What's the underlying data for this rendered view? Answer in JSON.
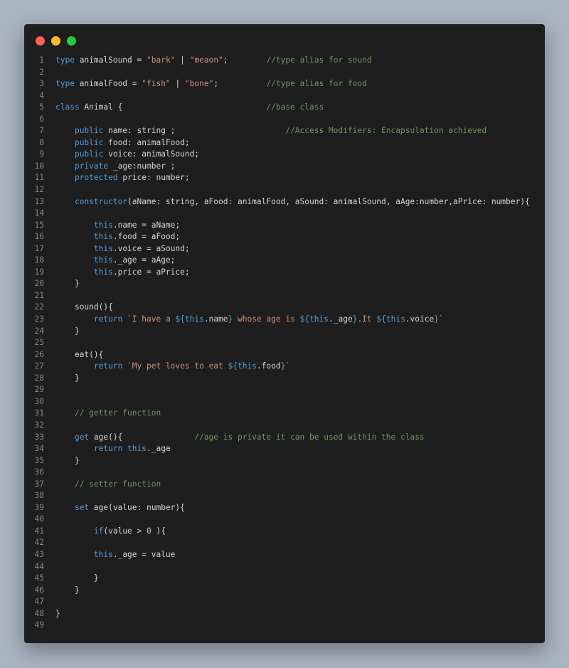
{
  "window": {
    "traffic_lights": [
      {
        "name": "close",
        "color": "#ff5f56"
      },
      {
        "name": "minimize",
        "color": "#ffbd2e"
      },
      {
        "name": "maximize",
        "color": "#27c93f"
      }
    ]
  },
  "theme": {
    "keyword": "#569cd6",
    "string": "#ce9178",
    "comment": "#6a9955",
    "number": "#b5cea8",
    "plain": "#d4d4d4",
    "line_number": "#858585",
    "background": "#1e1e1e"
  },
  "lines": [
    {
      "n": "1",
      "tokens": [
        {
          "t": "kw",
          "v": "type"
        },
        {
          "t": "pl",
          "v": " animalSound = "
        },
        {
          "t": "str",
          "v": "\"bark\""
        },
        {
          "t": "pl",
          "v": " | "
        },
        {
          "t": "str",
          "v": "\"meaon\""
        },
        {
          "t": "pl",
          "v": ";        "
        },
        {
          "t": "cm",
          "v": "//type alias for sound"
        }
      ]
    },
    {
      "n": "2",
      "tokens": []
    },
    {
      "n": "3",
      "tokens": [
        {
          "t": "kw",
          "v": "type"
        },
        {
          "t": "pl",
          "v": " animalFood = "
        },
        {
          "t": "str",
          "v": "\"fish\""
        },
        {
          "t": "pl",
          "v": " | "
        },
        {
          "t": "str",
          "v": "\"bone\""
        },
        {
          "t": "pl",
          "v": ";          "
        },
        {
          "t": "cm",
          "v": "//type alias for food"
        }
      ]
    },
    {
      "n": "4",
      "tokens": []
    },
    {
      "n": "5",
      "tokens": [
        {
          "t": "kw",
          "v": "class"
        },
        {
          "t": "pl",
          "v": " Animal {                              "
        },
        {
          "t": "cm",
          "v": "//base class"
        }
      ]
    },
    {
      "n": "6",
      "tokens": []
    },
    {
      "n": "7",
      "tokens": [
        {
          "t": "pl",
          "v": "    "
        },
        {
          "t": "kw",
          "v": "public"
        },
        {
          "t": "pl",
          "v": " name: string ;                       "
        },
        {
          "t": "cm",
          "v": "//Access Modifiers: Encapsulation achieved"
        }
      ]
    },
    {
      "n": "8",
      "tokens": [
        {
          "t": "pl",
          "v": "    "
        },
        {
          "t": "kw",
          "v": "public"
        },
        {
          "t": "pl",
          "v": " food: animalFood;"
        }
      ]
    },
    {
      "n": "9",
      "tokens": [
        {
          "t": "pl",
          "v": "    "
        },
        {
          "t": "kw",
          "v": "public"
        },
        {
          "t": "pl",
          "v": " voice: animalSound;"
        }
      ]
    },
    {
      "n": "10",
      "tokens": [
        {
          "t": "pl",
          "v": "    "
        },
        {
          "t": "kw",
          "v": "private"
        },
        {
          "t": "pl",
          "v": " _age:number ;"
        }
      ]
    },
    {
      "n": "11",
      "tokens": [
        {
          "t": "pl",
          "v": "    "
        },
        {
          "t": "kw",
          "v": "protected"
        },
        {
          "t": "pl",
          "v": " price: number;"
        }
      ]
    },
    {
      "n": "12",
      "tokens": []
    },
    {
      "n": "13",
      "tokens": [
        {
          "t": "pl",
          "v": "    "
        },
        {
          "t": "kw",
          "v": "constructor"
        },
        {
          "t": "pl",
          "v": "(aName: string, aFood: animalFood, aSound: animalSound, aAge:number,aPrice: number){"
        }
      ]
    },
    {
      "n": "14",
      "tokens": []
    },
    {
      "n": "15",
      "tokens": [
        {
          "t": "pl",
          "v": "        "
        },
        {
          "t": "kw",
          "v": "this"
        },
        {
          "t": "pl",
          "v": ".name = aName;"
        }
      ]
    },
    {
      "n": "16",
      "tokens": [
        {
          "t": "pl",
          "v": "        "
        },
        {
          "t": "kw",
          "v": "this"
        },
        {
          "t": "pl",
          "v": ".food = aFood;"
        }
      ]
    },
    {
      "n": "17",
      "tokens": [
        {
          "t": "pl",
          "v": "        "
        },
        {
          "t": "kw",
          "v": "this"
        },
        {
          "t": "pl",
          "v": ".voice = aSound;"
        }
      ]
    },
    {
      "n": "18",
      "tokens": [
        {
          "t": "pl",
          "v": "        "
        },
        {
          "t": "kw",
          "v": "this"
        },
        {
          "t": "pl",
          "v": "._age = aAge;"
        }
      ]
    },
    {
      "n": "19",
      "tokens": [
        {
          "t": "pl",
          "v": "        "
        },
        {
          "t": "kw",
          "v": "this"
        },
        {
          "t": "pl",
          "v": ".price = aPrice;"
        }
      ]
    },
    {
      "n": "20",
      "tokens": [
        {
          "t": "pl",
          "v": "    }"
        }
      ]
    },
    {
      "n": "21",
      "tokens": []
    },
    {
      "n": "22",
      "tokens": [
        {
          "t": "pl",
          "v": "    sound(){"
        }
      ]
    },
    {
      "n": "23",
      "tokens": [
        {
          "t": "pl",
          "v": "        "
        },
        {
          "t": "kw",
          "v": "return"
        },
        {
          "t": "pl",
          "v": " "
        },
        {
          "t": "str",
          "v": "`I have a "
        },
        {
          "t": "kw",
          "v": "${this"
        },
        {
          "t": "pl",
          "v": ".name"
        },
        {
          "t": "kw",
          "v": "}"
        },
        {
          "t": "str",
          "v": " whose age is "
        },
        {
          "t": "kw",
          "v": "${this"
        },
        {
          "t": "pl",
          "v": "._age"
        },
        {
          "t": "kw",
          "v": "}"
        },
        {
          "t": "str",
          "v": ".It "
        },
        {
          "t": "kw",
          "v": "${this"
        },
        {
          "t": "pl",
          "v": ".voice"
        },
        {
          "t": "kw",
          "v": "}"
        },
        {
          "t": "str",
          "v": "`"
        }
      ]
    },
    {
      "n": "24",
      "tokens": [
        {
          "t": "pl",
          "v": "    }"
        }
      ]
    },
    {
      "n": "25",
      "tokens": []
    },
    {
      "n": "26",
      "tokens": [
        {
          "t": "pl",
          "v": "    eat(){"
        }
      ]
    },
    {
      "n": "27",
      "tokens": [
        {
          "t": "pl",
          "v": "        "
        },
        {
          "t": "kw",
          "v": "return"
        },
        {
          "t": "pl",
          "v": " "
        },
        {
          "t": "str",
          "v": "`My pet loves to eat "
        },
        {
          "t": "kw",
          "v": "${this"
        },
        {
          "t": "pl",
          "v": ".food"
        },
        {
          "t": "kw",
          "v": "}"
        },
        {
          "t": "str",
          "v": "`"
        }
      ]
    },
    {
      "n": "28",
      "tokens": [
        {
          "t": "pl",
          "v": "    }"
        }
      ]
    },
    {
      "n": "29",
      "tokens": []
    },
    {
      "n": "30",
      "tokens": []
    },
    {
      "n": "31",
      "tokens": [
        {
          "t": "pl",
          "v": "    "
        },
        {
          "t": "cm",
          "v": "// getter function"
        }
      ]
    },
    {
      "n": "32",
      "tokens": []
    },
    {
      "n": "33",
      "tokens": [
        {
          "t": "pl",
          "v": "    "
        },
        {
          "t": "kw",
          "v": "get"
        },
        {
          "t": "pl",
          "v": " age(){               "
        },
        {
          "t": "cm",
          "v": "//age is private it can be used within the class"
        }
      ]
    },
    {
      "n": "34",
      "tokens": [
        {
          "t": "pl",
          "v": "        "
        },
        {
          "t": "kw",
          "v": "return"
        },
        {
          "t": "pl",
          "v": " "
        },
        {
          "t": "kw",
          "v": "this"
        },
        {
          "t": "pl",
          "v": "._age"
        }
      ]
    },
    {
      "n": "35",
      "tokens": [
        {
          "t": "pl",
          "v": "    }"
        }
      ]
    },
    {
      "n": "36",
      "tokens": []
    },
    {
      "n": "37",
      "tokens": [
        {
          "t": "pl",
          "v": "    "
        },
        {
          "t": "cm",
          "v": "// setter function"
        }
      ]
    },
    {
      "n": "38",
      "tokens": []
    },
    {
      "n": "39",
      "tokens": [
        {
          "t": "pl",
          "v": "    "
        },
        {
          "t": "kw",
          "v": "set"
        },
        {
          "t": "pl",
          "v": " age(value: number){"
        }
      ]
    },
    {
      "n": "40",
      "tokens": []
    },
    {
      "n": "41",
      "tokens": [
        {
          "t": "pl",
          "v": "        "
        },
        {
          "t": "kw",
          "v": "if"
        },
        {
          "t": "pl",
          "v": "(value > "
        },
        {
          "t": "num",
          "v": "0"
        },
        {
          "t": "pl",
          "v": " ){"
        }
      ]
    },
    {
      "n": "42",
      "tokens": []
    },
    {
      "n": "43",
      "tokens": [
        {
          "t": "pl",
          "v": "        "
        },
        {
          "t": "kw",
          "v": "this"
        },
        {
          "t": "pl",
          "v": "._age = value"
        }
      ]
    },
    {
      "n": "44",
      "tokens": []
    },
    {
      "n": "45",
      "tokens": [
        {
          "t": "pl",
          "v": "        }"
        }
      ]
    },
    {
      "n": "46",
      "tokens": [
        {
          "t": "pl",
          "v": "    }"
        }
      ]
    },
    {
      "n": "47",
      "tokens": []
    },
    {
      "n": "48",
      "tokens": [
        {
          "t": "pl",
          "v": "}"
        }
      ]
    },
    {
      "n": "49",
      "tokens": []
    }
  ]
}
